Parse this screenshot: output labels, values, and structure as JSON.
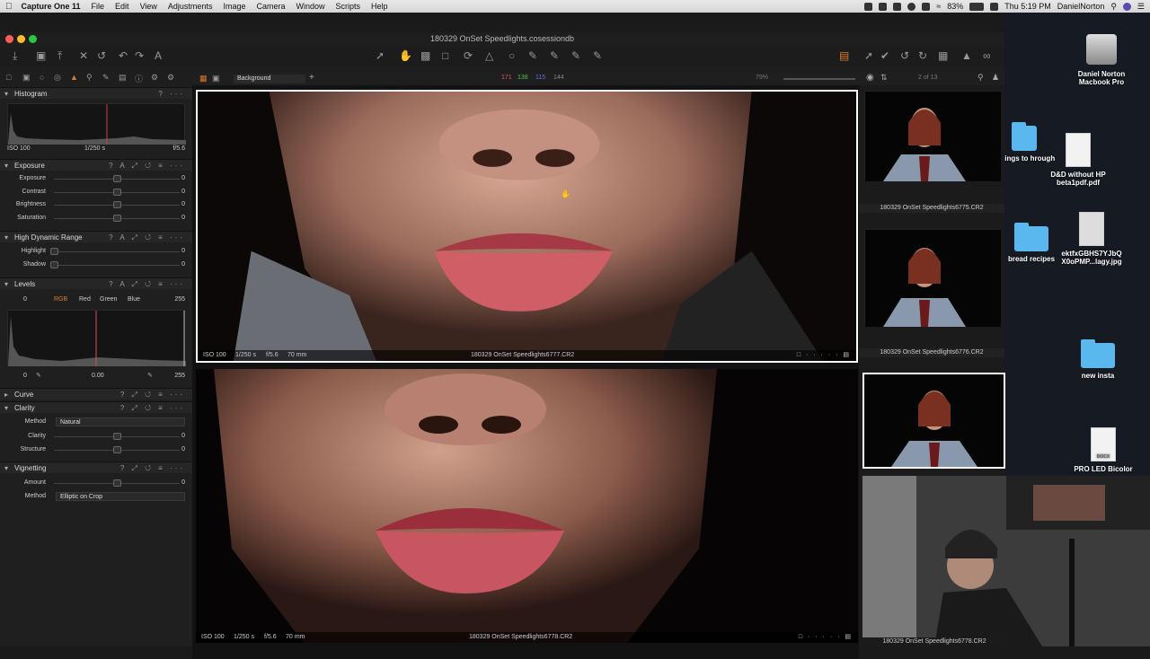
{
  "menubar": {
    "apple": "",
    "app_name": "Capture One 11",
    "items": [
      "File",
      "Edit",
      "View",
      "Adjustments",
      "Image",
      "Camera",
      "Window",
      "Scripts",
      "Help"
    ],
    "battery": "83%",
    "clock": "Thu 5:19 PM",
    "user": "DanielNorton"
  },
  "window": {
    "title": "180329 OnSet Speedlights.cosessiondb"
  },
  "viewer_toolbar": {
    "preset": "Background",
    "rgb_r": "171",
    "rgb_g": "138",
    "rgb_b": "115",
    "rgb_l": "144",
    "zoom": "79%",
    "count": "2 of 13"
  },
  "histogram": {
    "title": "Histogram",
    "iso": "ISO 100",
    "shutter": "1/250 s",
    "aperture": "f/5.6"
  },
  "exposure": {
    "title": "Exposure",
    "rows": [
      {
        "label": "Exposure",
        "value": "0",
        "level": 0.5
      },
      {
        "label": "Contrast",
        "value": "0",
        "level": 0.5
      },
      {
        "label": "Brightness",
        "value": "0",
        "level": 0.5
      },
      {
        "label": "Saturation",
        "value": "0",
        "level": 0.5
      }
    ]
  },
  "hdr": {
    "title": "High Dynamic Range",
    "rows": [
      {
        "label": "Highlight",
        "value": "0",
        "level": 0
      },
      {
        "label": "Shadow",
        "value": "0",
        "level": 0
      }
    ]
  },
  "levels": {
    "title": "Levels",
    "low": "0",
    "high": "255",
    "channels": [
      "RGB",
      "Red",
      "Green",
      "Blue"
    ],
    "out_low": "0",
    "mid": "0.00",
    "out_high": "255"
  },
  "curve": {
    "title": "Curve"
  },
  "clarity": {
    "title": "Clarity",
    "method_label": "Method",
    "method": "Natural",
    "rows": [
      {
        "label": "Clarity",
        "value": "0",
        "level": 0.5
      },
      {
        "label": "Structure",
        "value": "0",
        "level": 0.5
      }
    ]
  },
  "vignetting": {
    "title": "Vignetting",
    "rows": [
      {
        "label": "Amount",
        "value": "0",
        "level": 0.5
      }
    ],
    "method_label": "Method",
    "method": "Elliptic on Crop"
  },
  "viewer": {
    "top": {
      "iso": "ISO 100",
      "shutter": "1/250 s",
      "aperture": "f/5.6",
      "focal": "70 mm",
      "file": "180329 OnSet Speedlights6777.CR2"
    },
    "bottom": {
      "iso": "ISO 100",
      "shutter": "1/250 s",
      "aperture": "f/5.6",
      "focal": "70 mm",
      "file": "180329 OnSet Speedlights6778.CR2"
    }
  },
  "browser": {
    "thumbs": [
      "180329 OnSet Speedlights6775.CR2",
      "180329 OnSet Speedlights6776.CR2",
      "180329 OnSet Speedlights6778.CR2"
    ]
  },
  "desktop": {
    "drive": "Daniel Norton Macbook Pro",
    "f1": "f things to hrough",
    "f2": "D&D without HP beta1pdf.pdf",
    "f3": "bread recipes",
    "f4": "ektfxGBHS7YJbQ X0oPMP...lagy.jpg",
    "f5": "new insta",
    "f6": "PRO LED Bicolor",
    "docx": "DOCX"
  }
}
